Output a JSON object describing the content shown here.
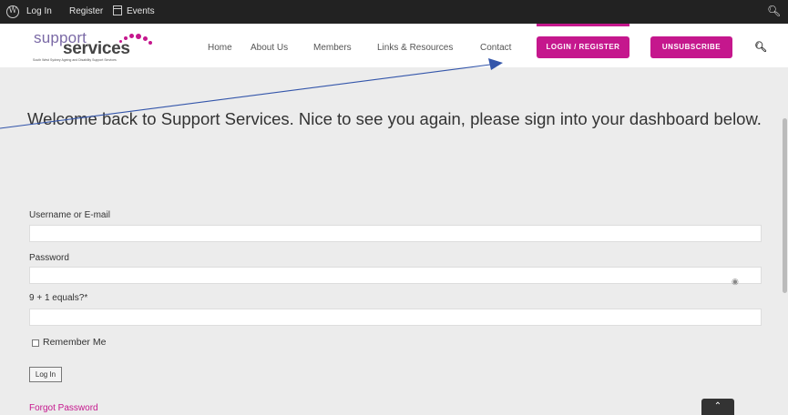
{
  "admin_bar": {
    "wp_glyph": "W",
    "login": "Log In",
    "register": "Register",
    "events": "Events"
  },
  "logo": {
    "line1": "support",
    "line2": "services",
    "tagline": "South West Sydney Ageing and Disability Support Services"
  },
  "nav": {
    "items": [
      "Home",
      "About Us",
      "Members",
      "Links & Resources",
      "Contact"
    ],
    "login_register": "LOGIN / REGISTER",
    "unsubscribe": "UNSUBSCRIBE"
  },
  "welcome": "Welcome back to Support Services. Nice to see you again, please sign into your dashboard below.",
  "form": {
    "username_label": "Username or E-mail",
    "username_value": "",
    "password_label": "Password",
    "password_value": "",
    "captcha_label": "9 + 1 equals?*",
    "captcha_value": "",
    "remember_label": "Remember Me",
    "login_button": "Log In",
    "forgot_link": "Forgot Password"
  },
  "colors": {
    "accent": "#c5178d",
    "admin_bar": "#222222",
    "page_bg": "#ececec",
    "annotation_arrow": "#3355aa"
  },
  "icons": [
    "wordpress-icon",
    "calendar-icon",
    "search-icon",
    "eye-icon",
    "chevron-up-icon"
  ]
}
